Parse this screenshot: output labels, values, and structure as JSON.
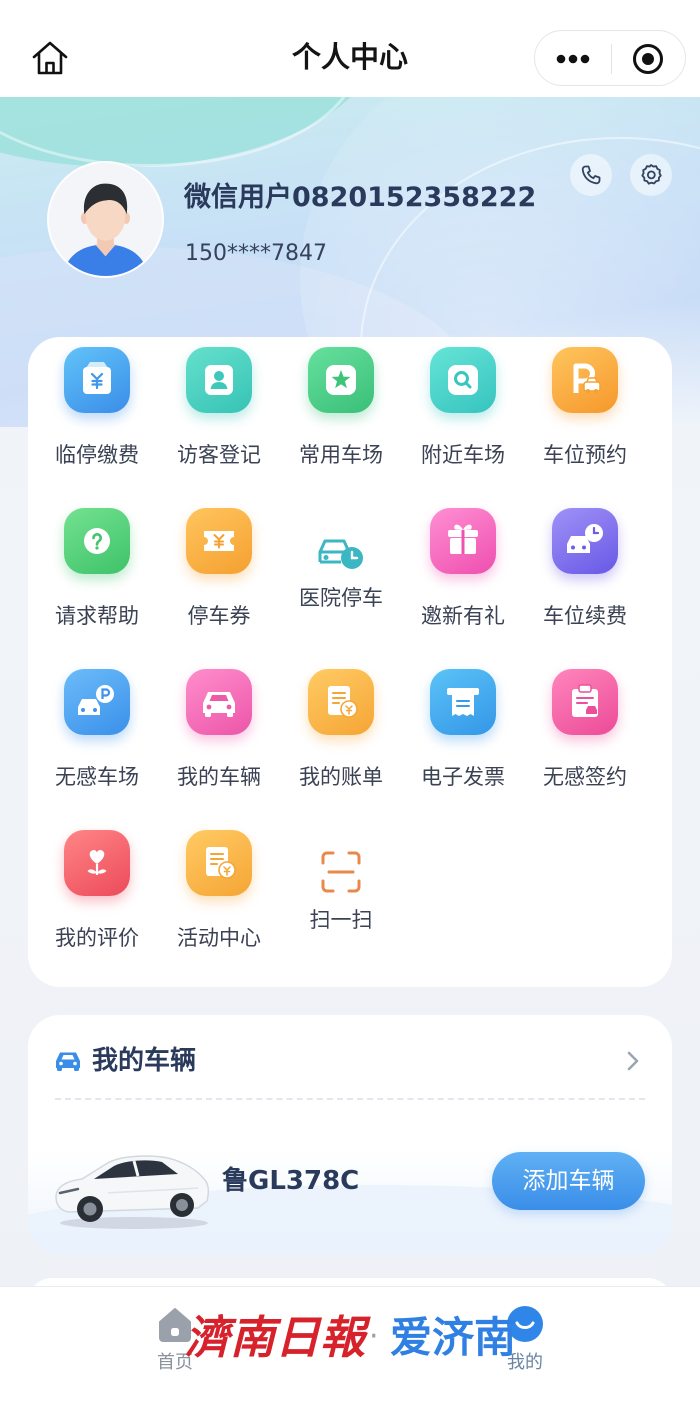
{
  "topbar": {
    "title": "个人中心",
    "home_icon": "home-icon",
    "more_icon": "more-dots-icon",
    "close_icon": "target-icon"
  },
  "profile": {
    "name": "微信用户0820152358222",
    "phone": "150****7847",
    "avatar_icon": "avatar-male-icon",
    "phone_icon": "phone-icon",
    "settings_icon": "gear-icon"
  },
  "services": {
    "items": [
      {
        "label": "临停缴费",
        "icon": "wallet-yen-icon",
        "colors": [
          "#62c3f8",
          "#3a8de8"
        ]
      },
      {
        "label": "访客登记",
        "icon": "person-icon",
        "colors": [
          "#66e0cc",
          "#36c3b6"
        ]
      },
      {
        "label": "常用车场",
        "icon": "star-icon",
        "colors": [
          "#66e09e",
          "#3abf78"
        ]
      },
      {
        "label": "附近车场",
        "icon": "search-icon",
        "colors": [
          "#66e4d6",
          "#36c4bf"
        ]
      },
      {
        "label": "车位预约",
        "icon": "parking-reserve-icon",
        "colors": [
          "#ffc55e",
          "#f5982c"
        ]
      },
      {
        "label": "请求帮助",
        "icon": "question-icon",
        "colors": [
          "#74e290",
          "#3ec26a"
        ]
      },
      {
        "label": "停车券",
        "icon": "ticket-icon",
        "colors": [
          "#ffc55e",
          "#f5a030"
        ]
      },
      {
        "label": "医院停车",
        "icon": "hospital-parking-icon",
        "colors": null
      },
      {
        "label": "邀新有礼",
        "icon": "gift-icon",
        "colors": [
          "#ff8fd4",
          "#ee4fae"
        ]
      },
      {
        "label": "车位续费",
        "icon": "car-clock-icon",
        "colors": [
          "#a092f7",
          "#6858e6"
        ]
      },
      {
        "label": "无感车场",
        "icon": "car-parking-icon",
        "colors": [
          "#6cbcf9",
          "#3a90ea"
        ]
      },
      {
        "label": "我的车辆",
        "icon": "car-icon",
        "colors": [
          "#ff8ecc",
          "#ec55a8"
        ]
      },
      {
        "label": "我的账单",
        "icon": "bill-icon",
        "colors": [
          "#ffcb64",
          "#f5a535"
        ]
      },
      {
        "label": "电子发票",
        "icon": "invoice-icon",
        "colors": [
          "#5cc3f7",
          "#3496e8"
        ]
      },
      {
        "label": "无感签约",
        "icon": "clipboard-icon",
        "colors": [
          "#ff86bc",
          "#ec4a98"
        ]
      },
      {
        "label": "我的评价",
        "icon": "heart-flower-icon",
        "colors": [
          "#ff8686",
          "#ec4a5a"
        ]
      },
      {
        "label": "活动中心",
        "icon": "activity-bill-icon",
        "colors": [
          "#ffcb64",
          "#f5a535"
        ]
      },
      {
        "label": "扫一扫",
        "icon": "scan-icon",
        "colors": null
      }
    ]
  },
  "vehicles": {
    "title": "我的车辆",
    "title_icon": "car-front-icon",
    "plate": "鲁GL378C",
    "add_button": "添加车辆"
  },
  "tabbar": {
    "tabs": [
      {
        "label": "首页",
        "icon": "home-solid-icon",
        "active": false
      },
      {
        "label": "我的",
        "icon": "profile-smile-icon",
        "active": true
      }
    ]
  },
  "watermark": {
    "left": "濟南日報",
    "separator": "·",
    "right": "爱济南"
  },
  "theme": {
    "accent": "#3a8ee8",
    "text_primary": "#2a3a5c",
    "watermark_red": "#d7222b",
    "watermark_blue": "#2f80e2"
  }
}
